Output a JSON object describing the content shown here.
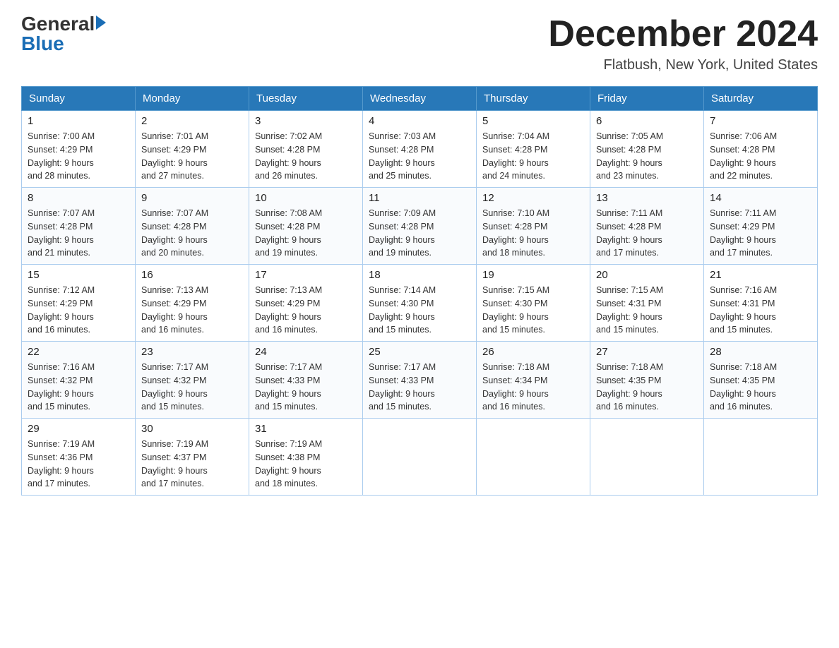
{
  "header": {
    "logo_general": "General",
    "logo_blue": "Blue",
    "month_title": "December 2024",
    "location": "Flatbush, New York, United States"
  },
  "days_of_week": [
    "Sunday",
    "Monday",
    "Tuesday",
    "Wednesday",
    "Thursday",
    "Friday",
    "Saturday"
  ],
  "weeks": [
    [
      {
        "day": "1",
        "sunrise": "7:00 AM",
        "sunset": "4:29 PM",
        "daylight": "9 hours and 28 minutes."
      },
      {
        "day": "2",
        "sunrise": "7:01 AM",
        "sunset": "4:29 PM",
        "daylight": "9 hours and 27 minutes."
      },
      {
        "day": "3",
        "sunrise": "7:02 AM",
        "sunset": "4:28 PM",
        "daylight": "9 hours and 26 minutes."
      },
      {
        "day": "4",
        "sunrise": "7:03 AM",
        "sunset": "4:28 PM",
        "daylight": "9 hours and 25 minutes."
      },
      {
        "day": "5",
        "sunrise": "7:04 AM",
        "sunset": "4:28 PM",
        "daylight": "9 hours and 24 minutes."
      },
      {
        "day": "6",
        "sunrise": "7:05 AM",
        "sunset": "4:28 PM",
        "daylight": "9 hours and 23 minutes."
      },
      {
        "day": "7",
        "sunrise": "7:06 AM",
        "sunset": "4:28 PM",
        "daylight": "9 hours and 22 minutes."
      }
    ],
    [
      {
        "day": "8",
        "sunrise": "7:07 AM",
        "sunset": "4:28 PM",
        "daylight": "9 hours and 21 minutes."
      },
      {
        "day": "9",
        "sunrise": "7:07 AM",
        "sunset": "4:28 PM",
        "daylight": "9 hours and 20 minutes."
      },
      {
        "day": "10",
        "sunrise": "7:08 AM",
        "sunset": "4:28 PM",
        "daylight": "9 hours and 19 minutes."
      },
      {
        "day": "11",
        "sunrise": "7:09 AM",
        "sunset": "4:28 PM",
        "daylight": "9 hours and 19 minutes."
      },
      {
        "day": "12",
        "sunrise": "7:10 AM",
        "sunset": "4:28 PM",
        "daylight": "9 hours and 18 minutes."
      },
      {
        "day": "13",
        "sunrise": "7:11 AM",
        "sunset": "4:28 PM",
        "daylight": "9 hours and 17 minutes."
      },
      {
        "day": "14",
        "sunrise": "7:11 AM",
        "sunset": "4:29 PM",
        "daylight": "9 hours and 17 minutes."
      }
    ],
    [
      {
        "day": "15",
        "sunrise": "7:12 AM",
        "sunset": "4:29 PM",
        "daylight": "9 hours and 16 minutes."
      },
      {
        "day": "16",
        "sunrise": "7:13 AM",
        "sunset": "4:29 PM",
        "daylight": "9 hours and 16 minutes."
      },
      {
        "day": "17",
        "sunrise": "7:13 AM",
        "sunset": "4:29 PM",
        "daylight": "9 hours and 16 minutes."
      },
      {
        "day": "18",
        "sunrise": "7:14 AM",
        "sunset": "4:30 PM",
        "daylight": "9 hours and 15 minutes."
      },
      {
        "day": "19",
        "sunrise": "7:15 AM",
        "sunset": "4:30 PM",
        "daylight": "9 hours and 15 minutes."
      },
      {
        "day": "20",
        "sunrise": "7:15 AM",
        "sunset": "4:31 PM",
        "daylight": "9 hours and 15 minutes."
      },
      {
        "day": "21",
        "sunrise": "7:16 AM",
        "sunset": "4:31 PM",
        "daylight": "9 hours and 15 minutes."
      }
    ],
    [
      {
        "day": "22",
        "sunrise": "7:16 AM",
        "sunset": "4:32 PM",
        "daylight": "9 hours and 15 minutes."
      },
      {
        "day": "23",
        "sunrise": "7:17 AM",
        "sunset": "4:32 PM",
        "daylight": "9 hours and 15 minutes."
      },
      {
        "day": "24",
        "sunrise": "7:17 AM",
        "sunset": "4:33 PM",
        "daylight": "9 hours and 15 minutes."
      },
      {
        "day": "25",
        "sunrise": "7:17 AM",
        "sunset": "4:33 PM",
        "daylight": "9 hours and 15 minutes."
      },
      {
        "day": "26",
        "sunrise": "7:18 AM",
        "sunset": "4:34 PM",
        "daylight": "9 hours and 16 minutes."
      },
      {
        "day": "27",
        "sunrise": "7:18 AM",
        "sunset": "4:35 PM",
        "daylight": "9 hours and 16 minutes."
      },
      {
        "day": "28",
        "sunrise": "7:18 AM",
        "sunset": "4:35 PM",
        "daylight": "9 hours and 16 minutes."
      }
    ],
    [
      {
        "day": "29",
        "sunrise": "7:19 AM",
        "sunset": "4:36 PM",
        "daylight": "9 hours and 17 minutes."
      },
      {
        "day": "30",
        "sunrise": "7:19 AM",
        "sunset": "4:37 PM",
        "daylight": "9 hours and 17 minutes."
      },
      {
        "day": "31",
        "sunrise": "7:19 AM",
        "sunset": "4:38 PM",
        "daylight": "9 hours and 18 minutes."
      },
      null,
      null,
      null,
      null
    ]
  ],
  "labels": {
    "sunrise": "Sunrise:",
    "sunset": "Sunset:",
    "daylight": "Daylight:"
  }
}
